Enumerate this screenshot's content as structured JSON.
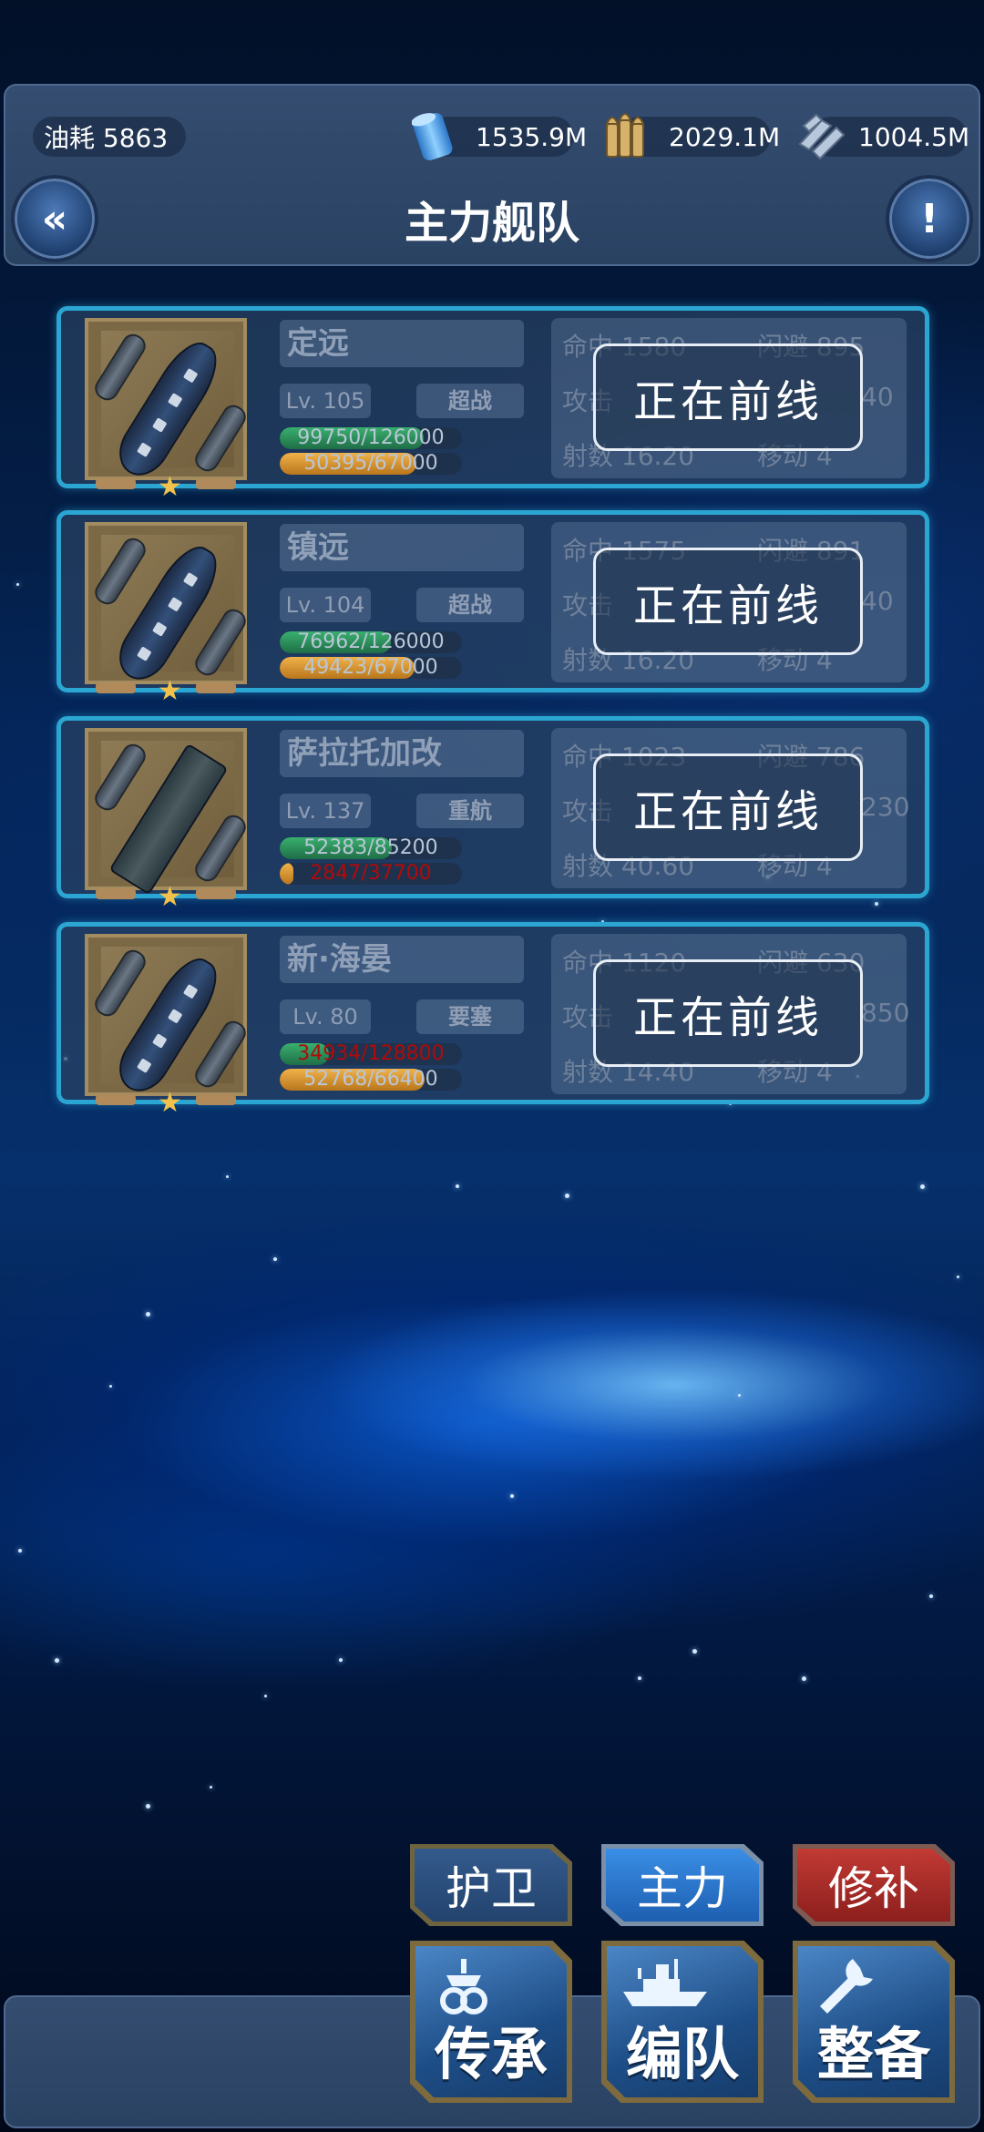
{
  "header": {
    "fuel_label": "油耗 5863",
    "title": "主力舰队",
    "back_icon": "double-chevron-left-icon",
    "info_icon": "exclamation-icon"
  },
  "resources": [
    {
      "icon": "oil-barrel-icon",
      "value": "1535.9M"
    },
    {
      "icon": "ammo-shells-icon",
      "value": "2029.1M"
    },
    {
      "icon": "steel-beam-icon",
      "value": "1004.5M"
    }
  ],
  "ships": [
    {
      "name": "定远",
      "level": "Lv. 105",
      "type": "超战",
      "hp_text": "99750/126000",
      "hp_fraction": 0.792,
      "hp_low": false,
      "fuel_text": "50395/67000",
      "fuel_fraction": 0.752,
      "fuel_low": false,
      "stats": {
        "hit": "命中 1580",
        "evade": "闪避 895",
        "attack": "攻击",
        "attack_tail": "40",
        "range": "射数 16.20",
        "move": "移动 4"
      },
      "status": "正在前线",
      "carrier": false
    },
    {
      "name": "镇远",
      "level": "Lv. 104",
      "type": "超战",
      "hp_text": "76962/126000",
      "hp_fraction": 0.611,
      "hp_low": false,
      "fuel_text": "49423/67000",
      "fuel_fraction": 0.738,
      "fuel_low": false,
      "stats": {
        "hit": "命中 1575",
        "evade": "闪避 891",
        "attack": "攻击",
        "attack_tail": "40",
        "range": "射数 16.20",
        "move": "移动 4"
      },
      "status": "正在前线",
      "carrier": false
    },
    {
      "name": "萨拉托加改",
      "level": "Lv. 137",
      "type": "重航",
      "hp_text": "52383/85200",
      "hp_fraction": 0.615,
      "hp_low": false,
      "fuel_text": "2847/37700",
      "fuel_fraction": 0.076,
      "fuel_low": true,
      "stats": {
        "hit": "命中 1023",
        "evade": "闪避 786",
        "attack": "攻击",
        "attack_tail": "230",
        "range": "射数 40.60",
        "move": "移动 4"
      },
      "status": "正在前线",
      "carrier": true
    },
    {
      "name": "新·海晏",
      "level": "Lv.  80",
      "type": "要塞",
      "hp_text": "34934/128800",
      "hp_fraction": 0.271,
      "hp_low": true,
      "fuel_text": "52768/66400",
      "fuel_fraction": 0.795,
      "fuel_low": false,
      "stats": {
        "hit": "命中 1120",
        "evade": "闪避 630",
        "attack": "攻击",
        "attack_tail": "850",
        "range": "射数 14.40",
        "move": "移动 4"
      },
      "status": "正在前线",
      "carrier": false
    }
  ],
  "tabs": [
    {
      "label": "护卫",
      "state": "normal"
    },
    {
      "label": "主力",
      "state": "active"
    },
    {
      "label": "修补",
      "state": "alert"
    }
  ],
  "actions": [
    {
      "label": "传承",
      "icon": "inheritance-icon"
    },
    {
      "label": "编队",
      "icon": "fleet-formation-icon"
    },
    {
      "label": "整备",
      "icon": "wrench-icon"
    }
  ],
  "colors": {
    "accent": "#2ba6d2",
    "panel": "#344d70",
    "hp": "#39b06e",
    "fuel": "#f0b24a",
    "alert": "#b10a0a"
  }
}
